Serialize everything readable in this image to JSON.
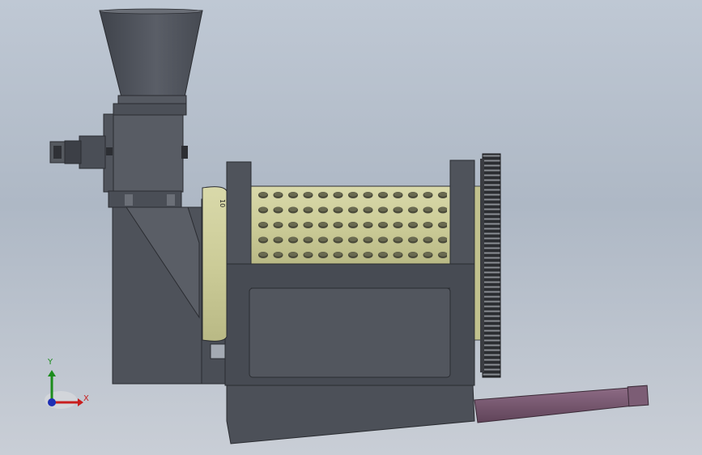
{
  "viewport": {
    "background_top": "#bfc8d4",
    "background_bottom": "#c9ced6"
  },
  "model": {
    "body_color": "#4f535c",
    "drum_color": "#cfcf9a",
    "discharge_pipe_color": "#7b5a72",
    "nameplate_text": "10"
  },
  "triad": {
    "x_label": "X",
    "y_label": "Y",
    "x_color": "#c81e1e",
    "y_color": "#1c8c1c",
    "z_color": "#1e2fb4"
  }
}
